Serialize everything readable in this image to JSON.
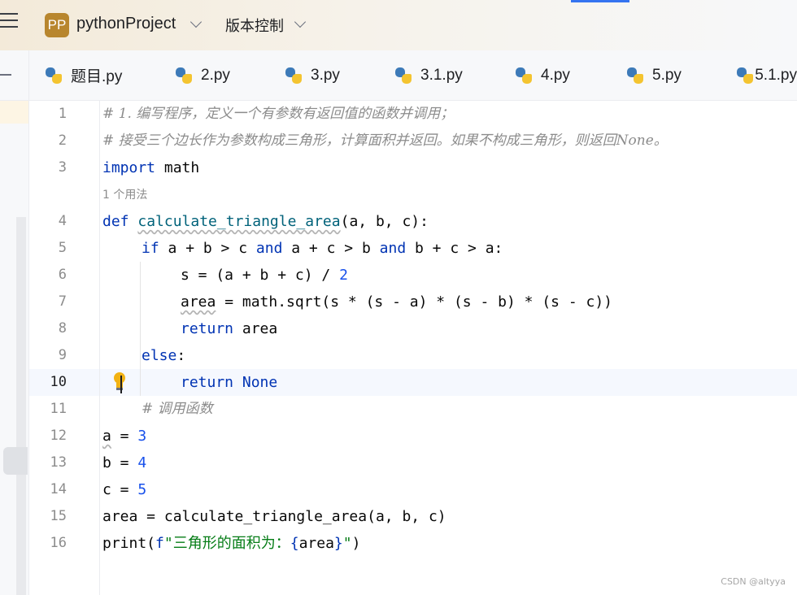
{
  "titlebar": {
    "project_badge": "PP",
    "project_name": "pythonProject",
    "vcs_label": "版本控制",
    "accent_color": "#3574f0",
    "badge_color": "#b8862e"
  },
  "tabs": [
    {
      "label": "题目.py",
      "icon": "python-file-icon"
    },
    {
      "label": "2.py",
      "icon": "python-file-icon"
    },
    {
      "label": "3.py",
      "icon": "python-file-icon"
    },
    {
      "label": "3.1.py",
      "icon": "python-file-icon"
    },
    {
      "label": "4.py",
      "icon": "python-file-icon"
    },
    {
      "label": "5.py",
      "icon": "python-file-icon"
    },
    {
      "label": "5.1.py",
      "icon": "python-file-icon"
    }
  ],
  "editor": {
    "current_line": "10",
    "usage_hint": "1 个用法",
    "line_numbers": [
      "1",
      "2",
      "3",
      "4",
      "5",
      "6",
      "7",
      "8",
      "9",
      "10",
      "11",
      "12",
      "13",
      "14",
      "15",
      "16"
    ],
    "comments": {
      "l1": "# 1. 编写程序，定义一个有参数有返回值的函数并调用；",
      "l2": "# 接受三个边长作为参数构成三角形，计算面积并返回。如果不构成三角形，则返回None。",
      "l11": "# 调用函数"
    },
    "tokens": {
      "import": "import",
      "math": " math",
      "def": "def",
      "fn_name": "calculate_triangle_area",
      "params": "(a, b, c):",
      "if": "if",
      "c1": " a + b > c ",
      "and1": "and",
      "c2": " a + c > b ",
      "and2": "and",
      "c3": " b + c > a:",
      "s_assign": "s = (a + b + c) / ",
      "two": "2",
      "area_var": "area",
      "area_expr": " = math.sqrt(s * (s - a) * (s - b) * (s - c))",
      "return1": "return",
      "return1_val": " area",
      "else": "else",
      "colon": ":",
      "return2": "return",
      "none": " None",
      "a_var": "a",
      "a_eq": " = ",
      "a_val": "3",
      "b_line": "b = ",
      "b_val": "4",
      "c_line": "c = ",
      "c_val": "5",
      "call_line": "area = calculate_triangle_area(a, b, c)",
      "print": "print(",
      "fprefix": "f",
      "fstr1": "\"三角形的面积为：",
      "fbrace_open": "{",
      "fvar": "area",
      "fbrace_close": "}",
      "fstr2": "\"",
      "close_paren": ")"
    }
  },
  "watermark": "CSDN @altyya"
}
